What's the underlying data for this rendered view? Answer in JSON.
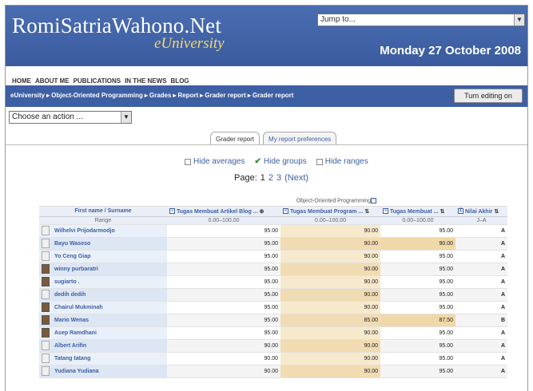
{
  "header": {
    "site_title": "RomiSatriaWahono.Net",
    "site_subtitle": "eUniversity",
    "jump_to": "Jump to...",
    "date": "Monday 27 October 2008"
  },
  "topnav": [
    "HOME",
    "ABOUT ME",
    "PUBLICATIONS",
    "IN THE NEWS",
    "BLOG"
  ],
  "breadcrumb": [
    "eUniversity",
    "Object-Oriented Programming",
    "Grades",
    "Report",
    "Grader report",
    "Grader report"
  ],
  "breadcrumb_sep": "▸",
  "edit_button": "Turn editing on",
  "action_select": "Choose an action ...",
  "tabs": [
    {
      "label": "Grader report",
      "active": true
    },
    {
      "label": "My report preferences",
      "active": false
    }
  ],
  "toggles": [
    {
      "label": "Hide averages",
      "checked": false
    },
    {
      "label": "Hide groups",
      "checked": true
    },
    {
      "label": "Hide ranges",
      "checked": false
    }
  ],
  "pager": {
    "label": "Page:",
    "current": "1",
    "pages": [
      "2",
      "3"
    ],
    "next": "(Next)"
  },
  "table": {
    "category": "Object-Oriented Programming",
    "name_header": "First name / Surname",
    "range_label": "Range",
    "columns": [
      {
        "label": "Tugas Membuat Artikel Blog ...",
        "range": "0.00–100.00"
      },
      {
        "label": "Tugas Membuat Program ...",
        "range": "0.00–100.00"
      },
      {
        "label": "Tugas Membuat ...",
        "range": "0.00–100.00"
      },
      {
        "label": "Nilai Akhir",
        "range": "J–A"
      }
    ],
    "rows": [
      {
        "name": "Wilhelvi Prijodarmodjo",
        "c1": "95.00",
        "c2": "90.00",
        "c3": "95.00",
        "grade": "A"
      },
      {
        "name": "Bayu Waseso",
        "c1": "95.00",
        "c2": "90.00",
        "c3": "90.00",
        "grade": "A"
      },
      {
        "name": "Yo Ceng Giap",
        "c1": "95.00",
        "c2": "90.00",
        "c3": "95.00",
        "grade": "A"
      },
      {
        "name": "winny purbaratri",
        "c1": "95.00",
        "c2": "90.00",
        "c3": "95.00",
        "grade": "A"
      },
      {
        "name": "sugiarto .",
        "c1": "95.00",
        "c2": "90.00",
        "c3": "95.00",
        "grade": "A"
      },
      {
        "name": "dedih dedih",
        "c1": "95.00",
        "c2": "90.00",
        "c3": "95.00",
        "grade": "A"
      },
      {
        "name": "Chairul Mukminah",
        "c1": "95.00",
        "c2": "90.00",
        "c3": "95.00",
        "grade": "A"
      },
      {
        "name": "Mario Wenas",
        "c1": "95.00",
        "c2": "85.00",
        "c3": "87.50",
        "grade": "B"
      },
      {
        "name": "Asep Ramdhani",
        "c1": "95.00",
        "c2": "90.00",
        "c3": "95.00",
        "grade": "A"
      },
      {
        "name": "Albert Arifin",
        "c1": "90.00",
        "c2": "90.00",
        "c3": "95.00",
        "grade": "A"
      },
      {
        "name": "Tatang tatang",
        "c1": "90.00",
        "c2": "90.00",
        "c3": "95.00",
        "grade": "A"
      },
      {
        "name": "Yudiana Yudiana",
        "c1": "90.00",
        "c2": "90.00",
        "c3": "95.00",
        "grade": "A"
      }
    ]
  },
  "colors": {
    "header_bg": "#3d5fa3",
    "subtitle": "#f5d76e",
    "link": "#3d5fa3",
    "highlight": "#f0d8a8"
  }
}
